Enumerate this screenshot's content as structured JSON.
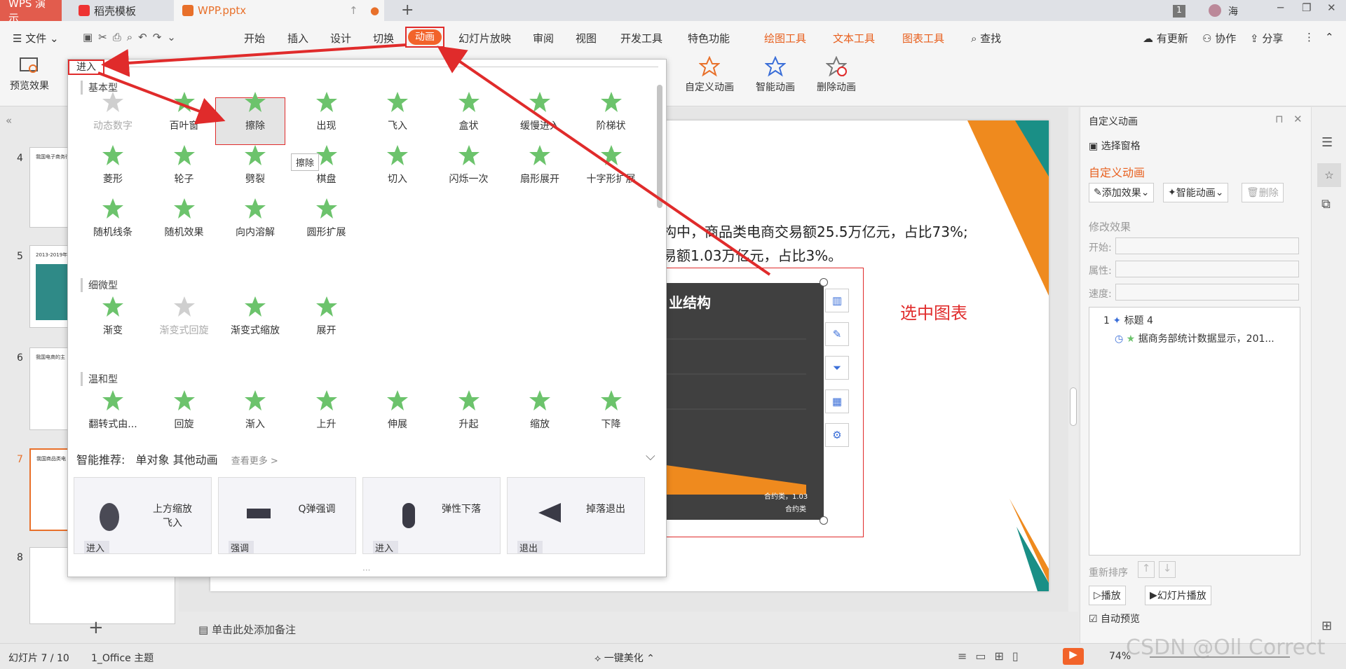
{
  "titlebar": {
    "app_tab": "WPS 演示",
    "tab2": "稻壳模板",
    "tab3": "WPP.pptx",
    "page_badge": "1",
    "user": "海"
  },
  "menu": {
    "file": "文件",
    "items": [
      "开始",
      "插入",
      "设计",
      "切换",
      "动画",
      "幻灯片放映",
      "审阅",
      "视图",
      "开发工具",
      "特色功能"
    ],
    "tool_items": [
      "绘图工具",
      "文本工具",
      "图表工具"
    ],
    "search": "查找",
    "right": [
      "有更新",
      "协作",
      "分享"
    ]
  },
  "ribbon": {
    "preview": "预览效果",
    "custom_anim": "自定义动画",
    "smart_anim": "智能动画",
    "delete_anim": "删除动画"
  },
  "dropdown": {
    "tab_enter": "进入",
    "section_basic": "基本型",
    "basic": [
      "动态数字",
      "百叶窗",
      "擦除",
      "出现",
      "飞入",
      "盒状",
      "缓慢进入",
      "阶梯状",
      "菱形",
      "轮子",
      "劈裂",
      "棋盘",
      "切入",
      "闪烁一次",
      "扇形展开",
      "十字形扩展",
      "随机线条",
      "随机效果",
      "向内溶解",
      "圆形扩展"
    ],
    "tooltip": "擦除",
    "section_subtle": "细微型",
    "subtle": [
      "渐变",
      "渐变式回旋",
      "渐变式缩放",
      "展开"
    ],
    "section_moderate": "温和型",
    "moderate": [
      "翻转式由...",
      "回旋",
      "渐入",
      "上升",
      "伸展",
      "升起",
      "缩放",
      "下降"
    ],
    "smart_title": "智能推荐:",
    "smart_sub": "单对象 其他动画",
    "see_more": "查看更多 >",
    "cards": [
      {
        "text": "上方缩放\n飞入",
        "tag": "进入"
      },
      {
        "text": "Q弹强调",
        "tag": "强调"
      },
      {
        "text": "弹性下落",
        "tag": "进入"
      },
      {
        "text": "掉落退出",
        "tag": "退出"
      }
    ]
  },
  "slides": {
    "numbers": [
      "4",
      "5",
      "6",
      "7",
      "8"
    ],
    "thumb4_title": "我国电子商务行",
    "thumb5_title": "2013-2019年",
    "thumb6_title": "我国电商的主",
    "thumb7_title": "我国商品类电",
    "current": "7"
  },
  "slide": {
    "text_line1": "构中，商品类电商交易额25.5万亿元，占比73%;",
    "text_line2": "易额1.03万亿元，占比3%。",
    "chart_title": "业结构",
    "chart_label1": "合约类，1.03",
    "chart_label2": "合约类",
    "annotation": "选中图表"
  },
  "rightpane": {
    "title": "自定义动画",
    "select_pane": "选择窗格",
    "section": "自定义动画",
    "add_effect": "添加效果",
    "smart_anim": "智能动画",
    "delete": "删除",
    "modify": "修改效果",
    "start": "开始:",
    "property": "属性:",
    "speed": "速度:",
    "list": [
      {
        "num": "1",
        "text": "标题 4"
      },
      {
        "num": "",
        "text": "据商务部统计数据显示，201..."
      }
    ],
    "reorder": "重新排序",
    "play": "播放",
    "slideshow": "幻灯片播放",
    "auto_preview": "自动预览"
  },
  "notes": "单击此处添加备注",
  "status": {
    "slide_count": "幻灯片 7 / 10",
    "theme": "1_Office 主题",
    "beautify": "一键美化",
    "zoom": "74%",
    "watermark": "CSDN @Oll Correct"
  },
  "colors": {
    "accent_red": "#e02b2b",
    "anim_tab": "#f2632a",
    "green_star": "#6cc36c",
    "orange": "#ef8a1e",
    "teal": "#1a8f86",
    "tool_orange": "#e85f1d"
  }
}
